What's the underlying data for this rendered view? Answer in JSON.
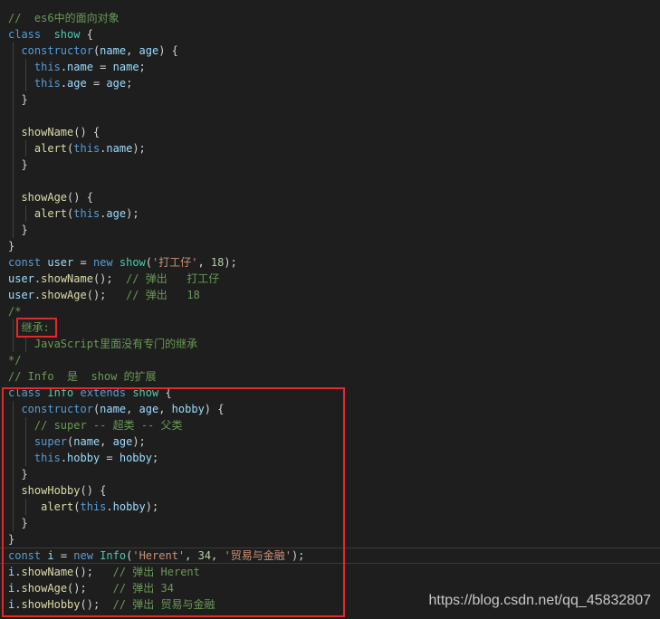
{
  "watermark": "https://blog.csdn.net/qq_45832807",
  "colors": {
    "background": "#1e1e1e",
    "comment": "#6a9955",
    "keyword": "#569cd6",
    "identifier": "#9cdcfe",
    "function": "#dcdcaa",
    "class": "#4ec9b0",
    "string": "#ce9178",
    "number": "#b5cea8",
    "highlight_box": "#e0282d"
  },
  "lines": [
    {
      "guides": [],
      "tokens": [
        {
          "t": "//  es6中的面向对象",
          "c": "cm"
        }
      ]
    },
    {
      "guides": [],
      "tokens": [
        {
          "t": "class",
          "c": "kw"
        },
        {
          "t": "  ",
          "c": "pl"
        },
        {
          "t": "show",
          "c": "cls"
        },
        {
          "t": " {",
          "c": "pl"
        }
      ]
    },
    {
      "guides": [
        1
      ],
      "tokens": [
        {
          "t": "  ",
          "c": "pl"
        },
        {
          "t": "constructor",
          "c": "kw"
        },
        {
          "t": "(",
          "c": "pl"
        },
        {
          "t": "name",
          "c": "id"
        },
        {
          "t": ", ",
          "c": "pl"
        },
        {
          "t": "age",
          "c": "id"
        },
        {
          "t": ") {",
          "c": "pl"
        }
      ]
    },
    {
      "guides": [
        1,
        2
      ],
      "tokens": [
        {
          "t": "    ",
          "c": "pl"
        },
        {
          "t": "this",
          "c": "kw"
        },
        {
          "t": ".",
          "c": "pl"
        },
        {
          "t": "name",
          "c": "id"
        },
        {
          "t": " = ",
          "c": "pl"
        },
        {
          "t": "name",
          "c": "id"
        },
        {
          "t": ";",
          "c": "pl"
        }
      ]
    },
    {
      "guides": [
        1,
        2
      ],
      "tokens": [
        {
          "t": "    ",
          "c": "pl"
        },
        {
          "t": "this",
          "c": "kw"
        },
        {
          "t": ".",
          "c": "pl"
        },
        {
          "t": "age",
          "c": "id"
        },
        {
          "t": " = ",
          "c": "pl"
        },
        {
          "t": "age",
          "c": "id"
        },
        {
          "t": ";",
          "c": "pl"
        }
      ]
    },
    {
      "guides": [
        1
      ],
      "tokens": [
        {
          "t": "  }",
          "c": "pl"
        }
      ]
    },
    {
      "guides": [
        1
      ],
      "tokens": [
        {
          "t": "",
          "c": "pl"
        }
      ]
    },
    {
      "guides": [
        1
      ],
      "tokens": [
        {
          "t": "  ",
          "c": "pl"
        },
        {
          "t": "showName",
          "c": "fn"
        },
        {
          "t": "() {",
          "c": "pl"
        }
      ]
    },
    {
      "guides": [
        1,
        2
      ],
      "tokens": [
        {
          "t": "    ",
          "c": "pl"
        },
        {
          "t": "alert",
          "c": "fn"
        },
        {
          "t": "(",
          "c": "pl"
        },
        {
          "t": "this",
          "c": "kw"
        },
        {
          "t": ".",
          "c": "pl"
        },
        {
          "t": "name",
          "c": "id"
        },
        {
          "t": ");",
          "c": "pl"
        }
      ]
    },
    {
      "guides": [
        1
      ],
      "tokens": [
        {
          "t": "  }",
          "c": "pl"
        }
      ]
    },
    {
      "guides": [
        1
      ],
      "tokens": [
        {
          "t": "",
          "c": "pl"
        }
      ]
    },
    {
      "guides": [
        1
      ],
      "tokens": [
        {
          "t": "  ",
          "c": "pl"
        },
        {
          "t": "showAge",
          "c": "fn"
        },
        {
          "t": "() {",
          "c": "pl"
        }
      ]
    },
    {
      "guides": [
        1,
        2
      ],
      "tokens": [
        {
          "t": "    ",
          "c": "pl"
        },
        {
          "t": "alert",
          "c": "fn"
        },
        {
          "t": "(",
          "c": "pl"
        },
        {
          "t": "this",
          "c": "kw"
        },
        {
          "t": ".",
          "c": "pl"
        },
        {
          "t": "age",
          "c": "id"
        },
        {
          "t": ");",
          "c": "pl"
        }
      ]
    },
    {
      "guides": [
        1
      ],
      "tokens": [
        {
          "t": "  }",
          "c": "pl"
        }
      ]
    },
    {
      "guides": [],
      "tokens": [
        {
          "t": "}",
          "c": "pl"
        }
      ]
    },
    {
      "guides": [],
      "tokens": [
        {
          "t": "const",
          "c": "kw"
        },
        {
          "t": " ",
          "c": "pl"
        },
        {
          "t": "user",
          "c": "id"
        },
        {
          "t": " = ",
          "c": "pl"
        },
        {
          "t": "new",
          "c": "kw"
        },
        {
          "t": " ",
          "c": "pl"
        },
        {
          "t": "show",
          "c": "cls"
        },
        {
          "t": "(",
          "c": "pl"
        },
        {
          "t": "'打工仔'",
          "c": "str"
        },
        {
          "t": ", ",
          "c": "pl"
        },
        {
          "t": "18",
          "c": "num"
        },
        {
          "t": ");",
          "c": "pl"
        }
      ]
    },
    {
      "guides": [],
      "tokens": [
        {
          "t": "user",
          "c": "id"
        },
        {
          "t": ".",
          "c": "pl"
        },
        {
          "t": "showName",
          "c": "fn"
        },
        {
          "t": "();  ",
          "c": "pl"
        },
        {
          "t": "// 弹出   打工仔",
          "c": "cm"
        }
      ]
    },
    {
      "guides": [],
      "tokens": [
        {
          "t": "user",
          "c": "id"
        },
        {
          "t": ".",
          "c": "pl"
        },
        {
          "t": "showAge",
          "c": "fn"
        },
        {
          "t": "();   ",
          "c": "pl"
        },
        {
          "t": "// 弹出   18",
          "c": "cm"
        }
      ]
    },
    {
      "guides": [],
      "tokens": [
        {
          "t": "/*",
          "c": "cm"
        }
      ]
    },
    {
      "guides": [
        1
      ],
      "tokens": [
        {
          "t": "  继承:",
          "c": "cm"
        }
      ]
    },
    {
      "guides": [
        1,
        2
      ],
      "tokens": [
        {
          "t": "    JavaScript里面没有专门的继承",
          "c": "cm"
        }
      ]
    },
    {
      "guides": [],
      "tokens": [
        {
          "t": "*/",
          "c": "cm"
        }
      ]
    },
    {
      "guides": [],
      "tokens": [
        {
          "t": "// Info  是  show 的扩展",
          "c": "cm"
        }
      ]
    },
    {
      "guides": [],
      "tokens": [
        {
          "t": "class",
          "c": "kw"
        },
        {
          "t": " ",
          "c": "pl"
        },
        {
          "t": "Info",
          "c": "cls"
        },
        {
          "t": " ",
          "c": "pl"
        },
        {
          "t": "extends",
          "c": "kw"
        },
        {
          "t": " ",
          "c": "pl"
        },
        {
          "t": "show",
          "c": "cls"
        },
        {
          "t": " {",
          "c": "pl"
        }
      ]
    },
    {
      "guides": [
        1
      ],
      "tokens": [
        {
          "t": "  ",
          "c": "pl"
        },
        {
          "t": "constructor",
          "c": "kw"
        },
        {
          "t": "(",
          "c": "pl"
        },
        {
          "t": "name",
          "c": "id"
        },
        {
          "t": ", ",
          "c": "pl"
        },
        {
          "t": "age",
          "c": "id"
        },
        {
          "t": ", ",
          "c": "pl"
        },
        {
          "t": "hobby",
          "c": "id"
        },
        {
          "t": ") {",
          "c": "pl"
        }
      ]
    },
    {
      "guides": [
        1,
        2
      ],
      "tokens": [
        {
          "t": "    ",
          "c": "pl"
        },
        {
          "t": "// super -- 超类 -- 父类",
          "c": "cm"
        }
      ]
    },
    {
      "guides": [
        1,
        2
      ],
      "tokens": [
        {
          "t": "    ",
          "c": "pl"
        },
        {
          "t": "super",
          "c": "kw"
        },
        {
          "t": "(",
          "c": "pl"
        },
        {
          "t": "name",
          "c": "id"
        },
        {
          "t": ", ",
          "c": "pl"
        },
        {
          "t": "age",
          "c": "id"
        },
        {
          "t": ");",
          "c": "pl"
        }
      ]
    },
    {
      "guides": [
        1,
        2
      ],
      "tokens": [
        {
          "t": "    ",
          "c": "pl"
        },
        {
          "t": "this",
          "c": "kw"
        },
        {
          "t": ".",
          "c": "pl"
        },
        {
          "t": "hobby",
          "c": "id"
        },
        {
          "t": " = ",
          "c": "pl"
        },
        {
          "t": "hobby",
          "c": "id"
        },
        {
          "t": ";",
          "c": "pl"
        }
      ]
    },
    {
      "guides": [
        1
      ],
      "tokens": [
        {
          "t": "  }",
          "c": "pl"
        }
      ]
    },
    {
      "guides": [
        1
      ],
      "tokens": [
        {
          "t": "  ",
          "c": "pl"
        },
        {
          "t": "showHobby",
          "c": "fn"
        },
        {
          "t": "() {",
          "c": "pl"
        }
      ]
    },
    {
      "guides": [
        1,
        2
      ],
      "tokens": [
        {
          "t": "     ",
          "c": "pl"
        },
        {
          "t": "alert",
          "c": "fn"
        },
        {
          "t": "(",
          "c": "pl"
        },
        {
          "t": "this",
          "c": "kw"
        },
        {
          "t": ".",
          "c": "pl"
        },
        {
          "t": "hobby",
          "c": "id"
        },
        {
          "t": ");",
          "c": "pl"
        }
      ]
    },
    {
      "guides": [
        1
      ],
      "tokens": [
        {
          "t": "  }",
          "c": "pl"
        }
      ]
    },
    {
      "guides": [],
      "tokens": [
        {
          "t": "}",
          "c": "pl"
        }
      ]
    },
    {
      "guides": [],
      "tokens": [
        {
          "t": "const",
          "c": "kw"
        },
        {
          "t": " ",
          "c": "pl"
        },
        {
          "t": "i",
          "c": "id"
        },
        {
          "t": " = ",
          "c": "pl"
        },
        {
          "t": "new",
          "c": "kw"
        },
        {
          "t": " ",
          "c": "pl"
        },
        {
          "t": "Info",
          "c": "cls"
        },
        {
          "t": "(",
          "c": "pl"
        },
        {
          "t": "'Herent'",
          "c": "str"
        },
        {
          "t": ", ",
          "c": "pl"
        },
        {
          "t": "34",
          "c": "num"
        },
        {
          "t": ", ",
          "c": "pl"
        },
        {
          "t": "'贸易与金融'",
          "c": "str"
        },
        {
          "t": ");",
          "c": "pl"
        }
      ]
    },
    {
      "guides": [],
      "tokens": [
        {
          "t": "i",
          "c": "id"
        },
        {
          "t": ".",
          "c": "pl"
        },
        {
          "t": "showName",
          "c": "fn"
        },
        {
          "t": "();   ",
          "c": "pl"
        },
        {
          "t": "// 弹出 Herent",
          "c": "cm"
        }
      ]
    },
    {
      "guides": [],
      "tokens": [
        {
          "t": "i",
          "c": "id"
        },
        {
          "t": ".",
          "c": "pl"
        },
        {
          "t": "showAge",
          "c": "fn"
        },
        {
          "t": "();    ",
          "c": "pl"
        },
        {
          "t": "// 弹出 34",
          "c": "cm"
        }
      ]
    },
    {
      "guides": [],
      "tokens": [
        {
          "t": "i",
          "c": "id"
        },
        {
          "t": ".",
          "c": "pl"
        },
        {
          "t": "showHobby",
          "c": "fn"
        },
        {
          "t": "();  ",
          "c": "pl"
        },
        {
          "t": "// 弹出 贸易与金融",
          "c": "cm"
        }
      ]
    }
  ]
}
